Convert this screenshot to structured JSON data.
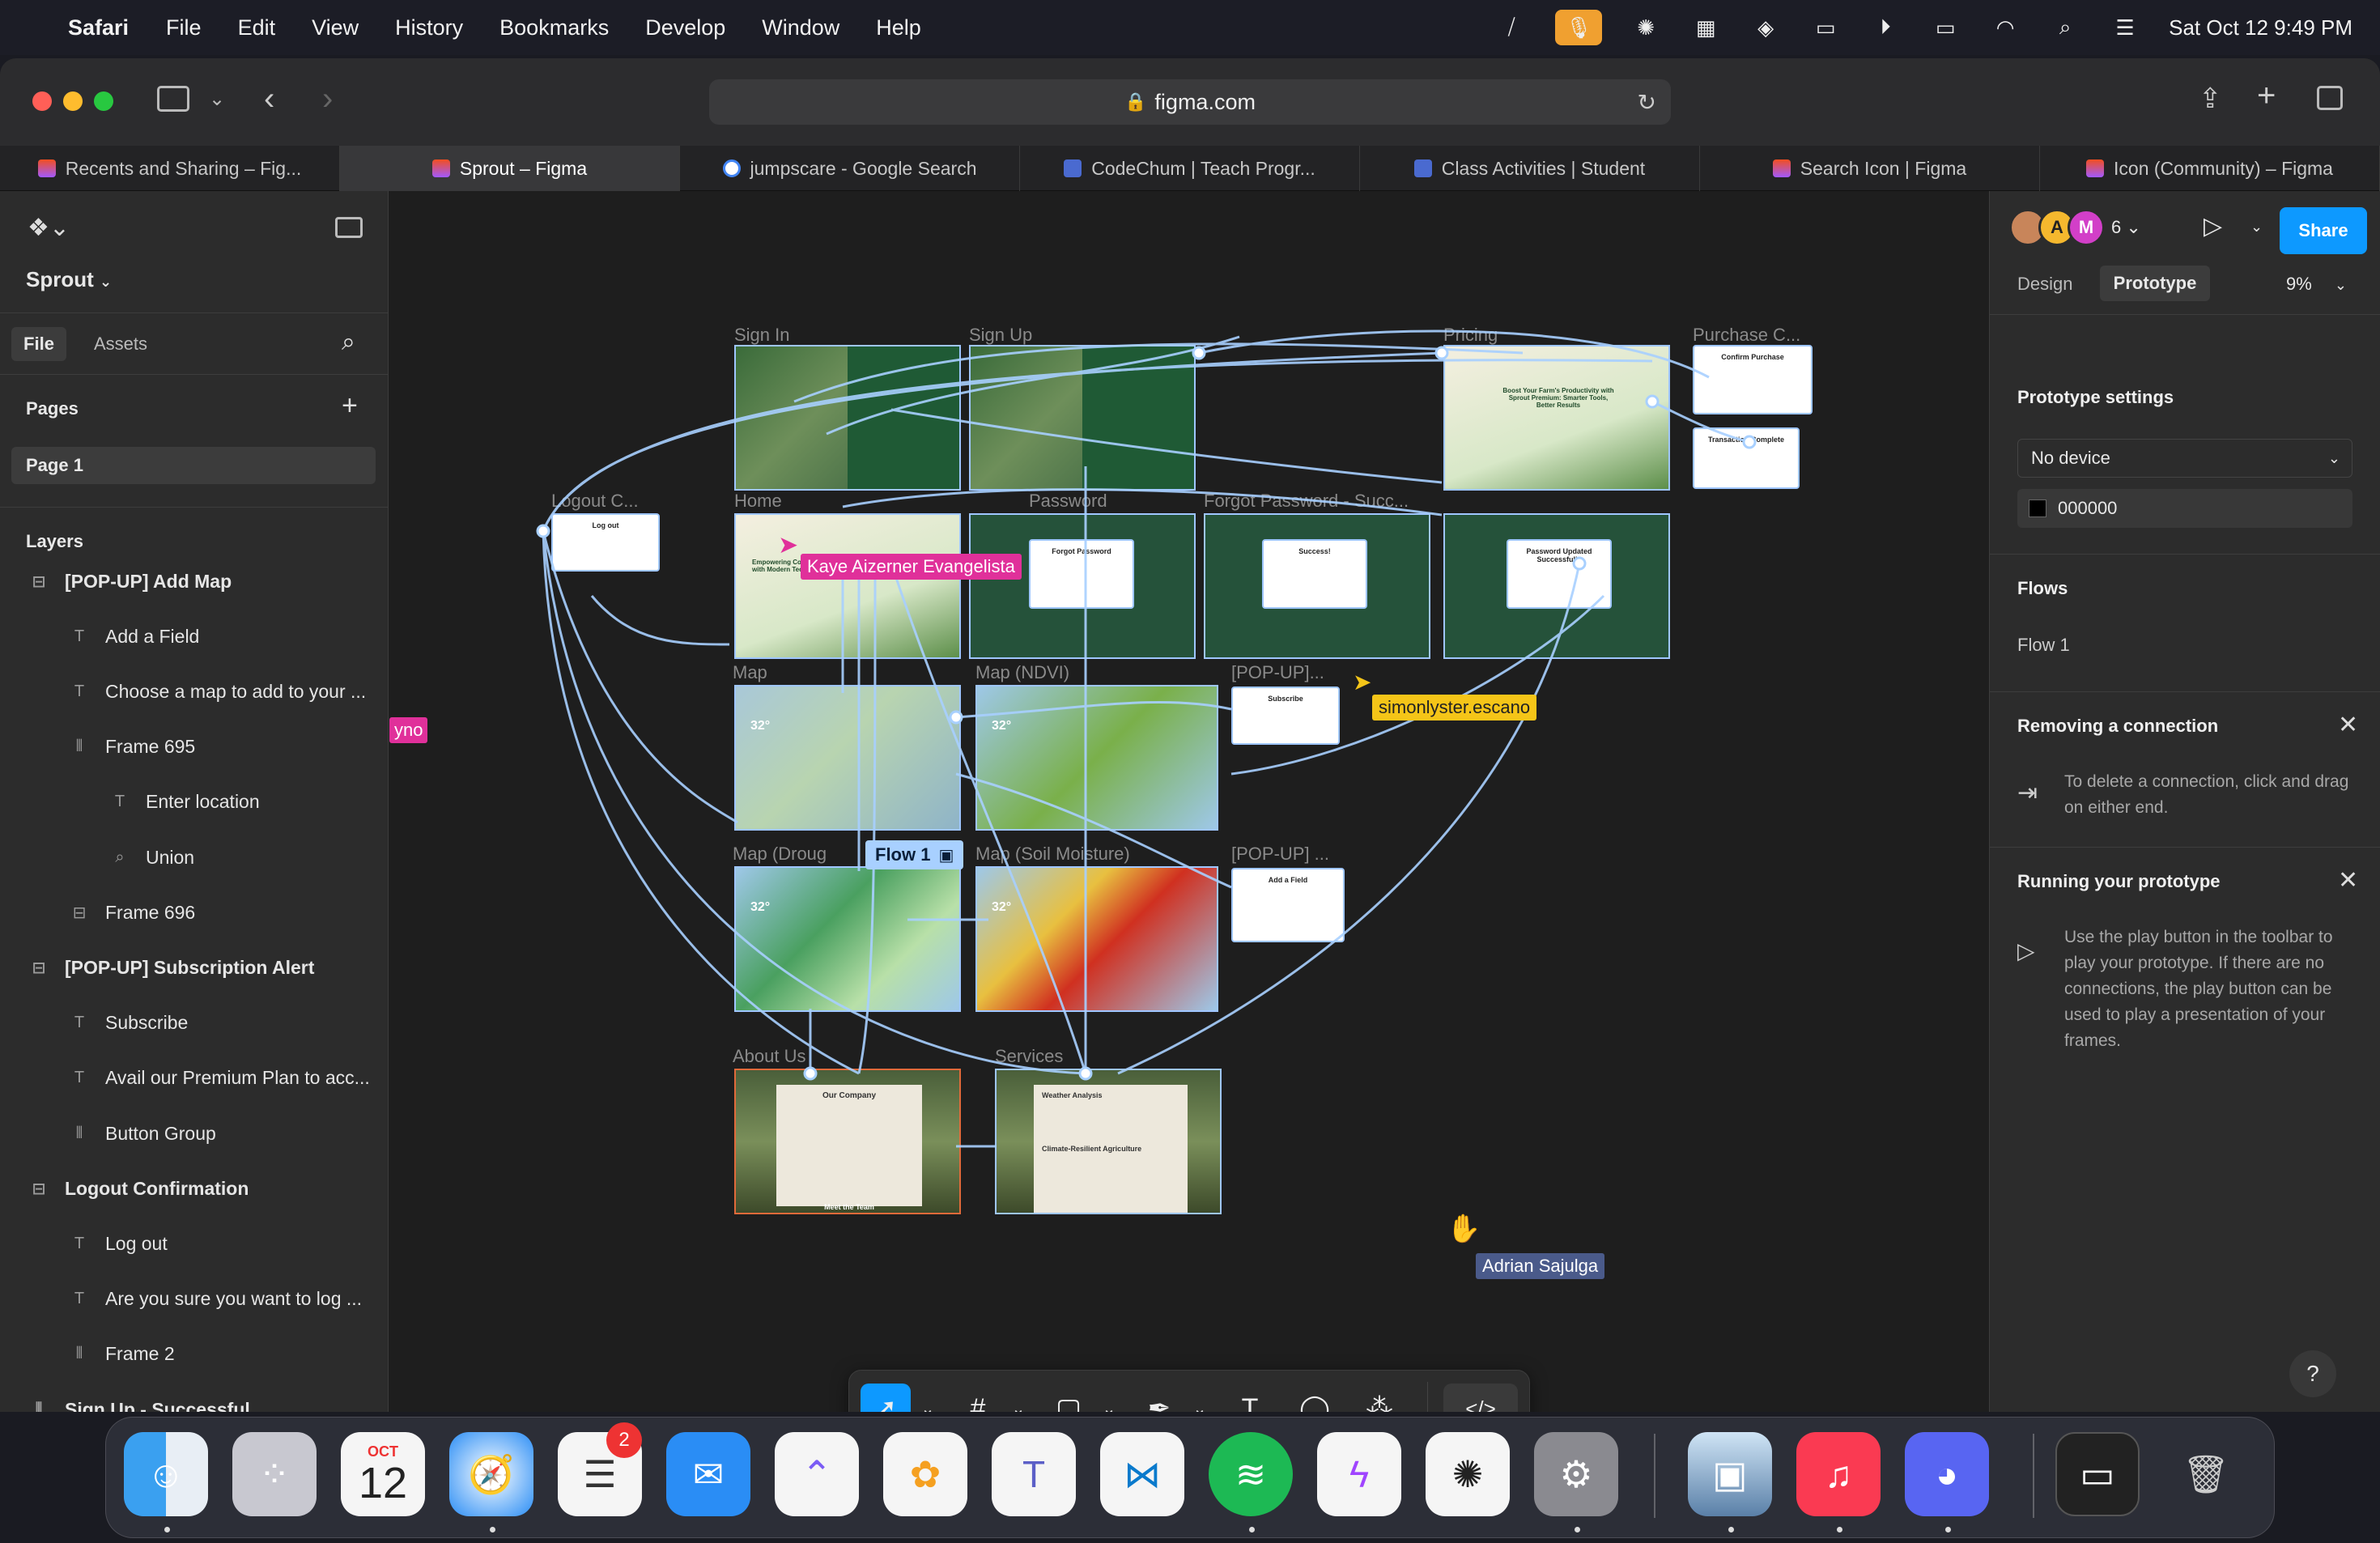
{
  "menubar": {
    "app_name": "Safari",
    "menus": [
      "File",
      "Edit",
      "View",
      "History",
      "Bookmarks",
      "Develop",
      "Window",
      "Help"
    ],
    "datetime": "Sat Oct 12  9:49 PM"
  },
  "browser": {
    "url": "figma.com",
    "tabs": [
      {
        "label": "Recents and Sharing – Fig...",
        "icon": "figma-icon"
      },
      {
        "label": "Sprout – Figma",
        "icon": "figma-icon",
        "active": true
      },
      {
        "label": "jumpscare - Google Search",
        "icon": "google-icon"
      },
      {
        "label": "CodeChum | Teach Progr...",
        "icon": "codechum-icon"
      },
      {
        "label": "Class Activities | Student",
        "icon": "codechum-icon"
      },
      {
        "label": "Search Icon | Figma",
        "icon": "figma-icon"
      },
      {
        "label": "Icon (Community) – Figma",
        "icon": "figma-icon"
      }
    ]
  },
  "left_panel": {
    "project_name": "Sprout",
    "tabs": {
      "file": "File",
      "assets": "Assets"
    },
    "pages_title": "Pages",
    "pages": [
      "Page 1"
    ],
    "layers_title": "Layers",
    "layers": [
      {
        "label": "[POP-UP] Add Map",
        "icon": "frame-section-icon",
        "indent": 0,
        "bold": true
      },
      {
        "label": "Add a Field",
        "icon": "text-icon",
        "indent": 1
      },
      {
        "label": "Choose a map to add to your ...",
        "icon": "text-icon",
        "indent": 1
      },
      {
        "label": "Frame 695",
        "icon": "autolayout-icon",
        "indent": 1
      },
      {
        "label": "Enter location",
        "icon": "text-icon",
        "indent": 2
      },
      {
        "label": "Union",
        "icon": "search-icon",
        "indent": 2
      },
      {
        "label": "Frame 696",
        "icon": "frame-section-icon",
        "indent": 1
      },
      {
        "label": "[POP-UP] Subscription Alert",
        "icon": "frame-section-icon",
        "indent": 0,
        "bold": true
      },
      {
        "label": "Subscribe",
        "icon": "text-icon",
        "indent": 1
      },
      {
        "label": "Avail our Premium Plan to acc...",
        "icon": "text-icon",
        "indent": 1
      },
      {
        "label": "Button Group",
        "icon": "autolayout-icon",
        "indent": 1
      },
      {
        "label": "Logout Confirmation",
        "icon": "frame-section-icon",
        "indent": 0,
        "bold": true
      },
      {
        "label": "Log out",
        "icon": "text-icon",
        "indent": 1
      },
      {
        "label": "Are you sure you want to log ...",
        "icon": "text-icon",
        "indent": 1
      },
      {
        "label": "Frame 2",
        "icon": "autolayout-icon",
        "indent": 1
      },
      {
        "label": "Sign Up - Successful",
        "icon": "autolayout-icon",
        "indent": 0,
        "bold": true
      }
    ]
  },
  "canvas": {
    "frame_labels": {
      "sign_in": "Sign In",
      "sign_up": "Sign Up",
      "pricing": "Pricing",
      "purchase": "Purchase C...",
      "logout": "Logout C...",
      "home": "Home",
      "forgot_password": "Password",
      "forgot_success": "Forgot Password - Succ...",
      "map": "Map",
      "map_ndvi": "Map (NDVI)",
      "popup_subscribe": "[POP-UP]...",
      "popup_add": "[POP-UP] ...",
      "map_drought": "Map (Droug",
      "map_soil": "Map (Soil Moisture)",
      "about": "About Us",
      "services": "Services"
    },
    "popups": {
      "logout": "Log out",
      "forgot": "Forgot Password",
      "success": "Success!",
      "pw_changed": "Password Updated Successfully",
      "subscribe": "Subscribe",
      "add_field": "Add a Field",
      "confirm": "Confirm Purchase",
      "complete": "Transaction Complete"
    },
    "frame_texts": {
      "home_heading": "Empowering Communities with Modern Technology",
      "pricing_heading": "Boost Your Farm's Productivity with Sprout Premium: Smarter Tools, Better Results",
      "about_heading": "Our Company",
      "about_footer": "Meet the Team",
      "services_heading": "Weather Analysis",
      "services_sub": "Climate-Resilient Agriculture",
      "map_temp": "32°"
    },
    "flow_label": "Flow 1",
    "cursors": [
      {
        "name": "Kaye Aizerner Evangelista",
        "color": "#e0309a"
      },
      {
        "name": "simonlyster.escano",
        "color": "#f5c518"
      },
      {
        "name": "Adrian Sajulga",
        "color": "#4a5a8a"
      },
      {
        "name": "yno",
        "color": "#e0309a"
      }
    ]
  },
  "right_panel": {
    "avatars": [
      {
        "initial": "",
        "color": "#c8855a"
      },
      {
        "initial": "A",
        "color": "#f5b82e"
      },
      {
        "initial": "M",
        "color": "#d23fc8"
      }
    ],
    "avatar_count": "6",
    "share_label": "Share",
    "tabs": {
      "design": "Design",
      "prototype": "Prototype"
    },
    "zoom": "9%",
    "prototype_settings_title": "Prototype settings",
    "device": "No device",
    "bg_color": "000000",
    "flows_title": "Flows",
    "flows": [
      "Flow 1"
    ],
    "removing_title": "Removing a connection",
    "removing_text": "To delete a connection, click and drag on either end.",
    "running_title": "Running your prototype",
    "running_text": "Use the play button in the toolbar to play your prototype. If there are no connections, the play button can be used to play a presentation of your frames.",
    "help": "?"
  },
  "dock": {
    "calendar_month": "OCT",
    "calendar_day": "12",
    "reminders_badge": "2"
  }
}
